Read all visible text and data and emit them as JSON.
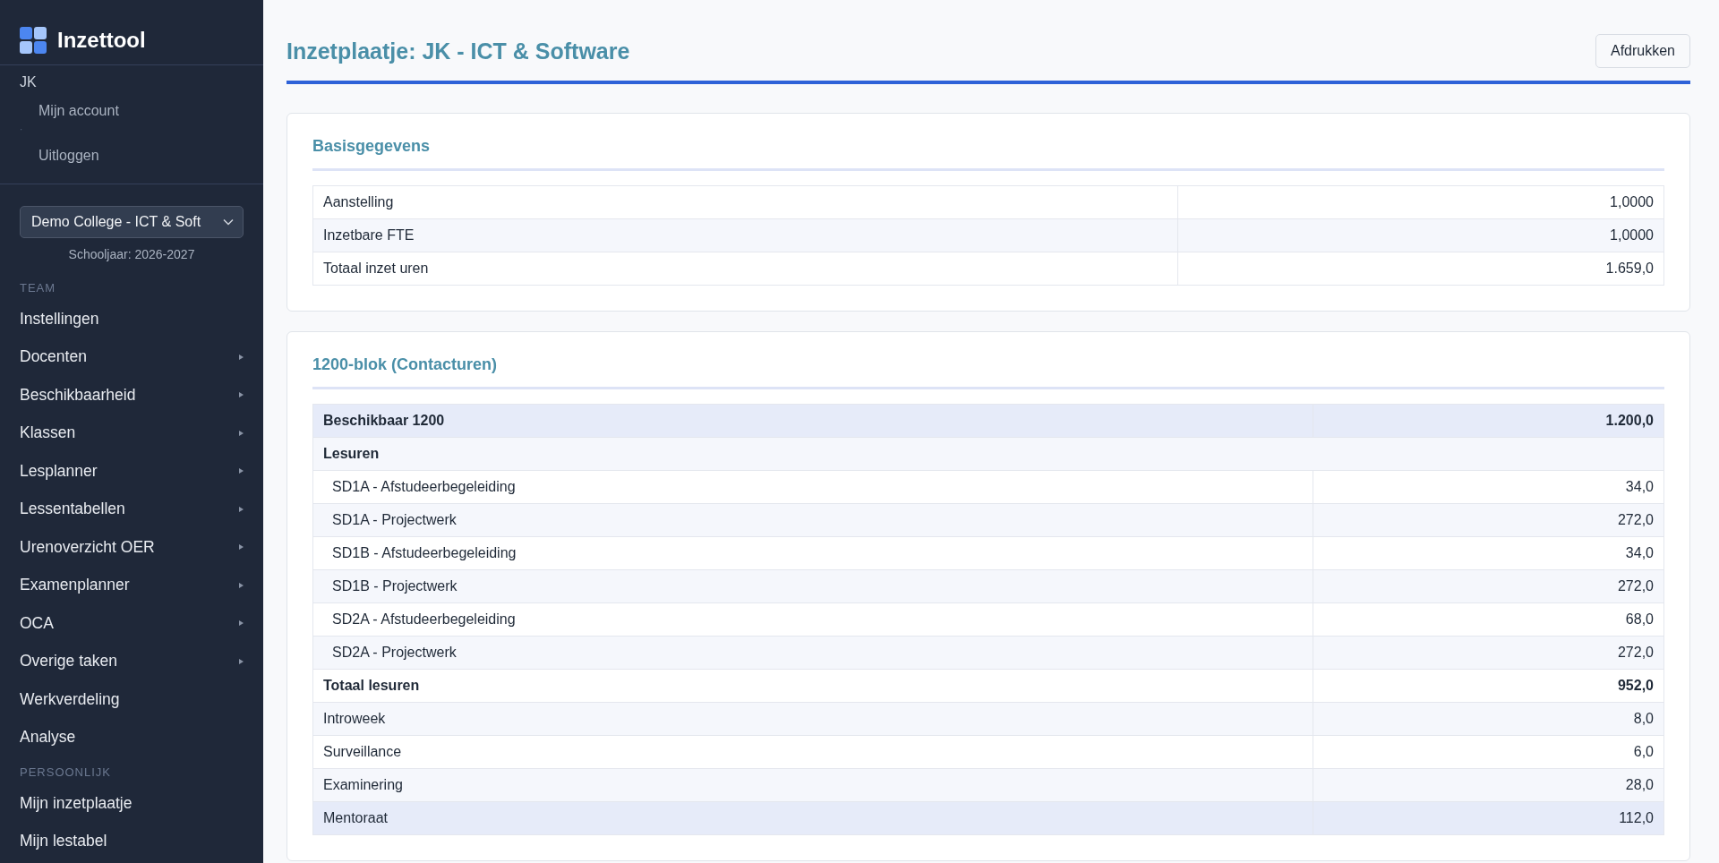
{
  "sidebar": {
    "brand": "Inzettool",
    "user": {
      "name": "JK",
      "links": [
        {
          "label": "Mijn account"
        },
        {
          "label": "·",
          "kind": "separator"
        },
        {
          "label": "Uitloggen"
        }
      ]
    },
    "school_select": {
      "value": "Demo College - ICT & Soft"
    },
    "school_year": "Schooljaar: 2026-2027",
    "sections": [
      {
        "heading": "TEAM",
        "items": [
          {
            "label": "Instellingen",
            "has_submenu": false
          },
          {
            "label": "Docenten",
            "has_submenu": true
          },
          {
            "label": "Beschikbaarheid",
            "has_submenu": true
          },
          {
            "label": "Klassen",
            "has_submenu": true
          },
          {
            "label": "Lesplanner",
            "has_submenu": true
          },
          {
            "label": "Lessentabellen",
            "has_submenu": true
          },
          {
            "label": "Urenoverzicht OER",
            "has_submenu": true
          },
          {
            "label": "Examenplanner",
            "has_submenu": true
          },
          {
            "label": "OCA",
            "has_submenu": true
          },
          {
            "label": "Overige taken",
            "has_submenu": true
          },
          {
            "label": "Werkverdeling",
            "has_submenu": false
          },
          {
            "label": "Analyse",
            "has_submenu": false
          }
        ]
      },
      {
        "heading": "PERSOONLIJK",
        "items": [
          {
            "label": "Mijn inzetplaatje",
            "has_submenu": false
          },
          {
            "label": "Mijn lestabel",
            "has_submenu": false
          }
        ]
      }
    ]
  },
  "header": {
    "title": "Inzetplaatje: JK - ICT & Software",
    "print_button": "Afdrukken"
  },
  "cards": [
    {
      "title": "Basisgegevens",
      "rows": [
        {
          "kind": "plain",
          "label": "Aanstelling",
          "value": "1,0000",
          "highlighted": false
        },
        {
          "kind": "plain",
          "label": "Inzetbare FTE",
          "value": "1,0000",
          "highlighted": false
        },
        {
          "kind": "plain",
          "label": "Totaal inzet uren",
          "value": "1.659,0",
          "highlighted": false
        }
      ]
    },
    {
      "title": "1200-blok (Contacturen)",
      "rows": [
        {
          "kind": "total",
          "label": "Beschikbaar 1200",
          "value": "1.200,0",
          "highlighted": true
        },
        {
          "kind": "group",
          "label": "Lesuren",
          "highlighted": false
        },
        {
          "kind": "item",
          "label": "SD1A - Afstudeerbegeleiding",
          "value": "34,0",
          "highlighted": false
        },
        {
          "kind": "item",
          "label": "SD1A - Projectwerk",
          "value": "272,0",
          "highlighted": false
        },
        {
          "kind": "item",
          "label": "SD1B - Afstudeerbegeleiding",
          "value": "34,0",
          "highlighted": false
        },
        {
          "kind": "item",
          "label": "SD1B - Projectwerk",
          "value": "272,0",
          "highlighted": false
        },
        {
          "kind": "item",
          "label": "SD2A - Afstudeerbegeleiding",
          "value": "68,0",
          "highlighted": false
        },
        {
          "kind": "item",
          "label": "SD2A - Projectwerk",
          "value": "272,0",
          "highlighted": false
        },
        {
          "kind": "total",
          "label": "Totaal lesuren",
          "value": "952,0",
          "highlighted": false
        },
        {
          "kind": "plain",
          "label": "Introweek",
          "value": "8,0",
          "highlighted": false
        },
        {
          "kind": "plain",
          "label": "Surveillance",
          "value": "6,0",
          "highlighted": false
        },
        {
          "kind": "plain",
          "label": "Examinering",
          "value": "28,0",
          "highlighted": false
        },
        {
          "kind": "plain",
          "label": "Mentoraat",
          "value": "112,0",
          "highlighted": true
        }
      ]
    }
  ]
}
